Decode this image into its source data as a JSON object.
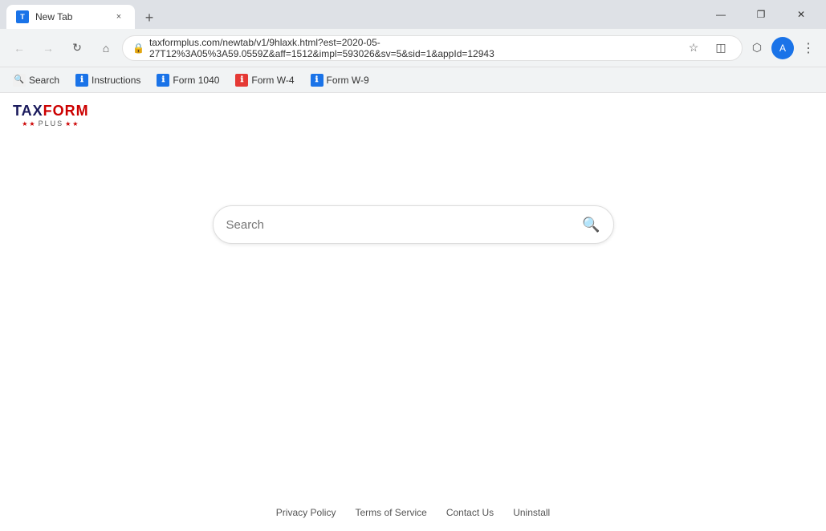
{
  "titlebar": {
    "tab_favicon": "T",
    "tab_title": "New Tab",
    "tab_close": "×",
    "new_tab_btn": "+",
    "win_minimize": "—",
    "win_maximize": "❐",
    "win_close": "✕"
  },
  "addressbar": {
    "back_icon": "←",
    "forward_icon": "→",
    "refresh_icon": "↻",
    "home_icon": "⌂",
    "lock_icon": "🔒",
    "url": "taxformplus.com/newtab/v1/9hlaxk.html?est=2020-05-27T12%3A05%3A59.0559Z&aff=1512&impl=593026&sv=5&sid=1&appId=12943",
    "bookmark_icon": "☆",
    "screenshot_icon": "◫",
    "extensions_icon": "⬡",
    "profile_letter": "A",
    "menu_icon": "⋮"
  },
  "bookmarkbar": {
    "items": [
      {
        "label": "Search",
        "icon_text": "🔍",
        "icon_bg": "#f0f0f0"
      },
      {
        "label": "Instructions",
        "icon_text": "ℹ",
        "icon_bg": "#1a73e8",
        "icon_color": "#fff"
      },
      {
        "label": "Form 1040",
        "icon_text": "ℹ",
        "icon_bg": "#1a73e8",
        "icon_color": "#fff"
      },
      {
        "label": "Form W-4",
        "icon_text": "ℹ",
        "icon_bg": "#e53935",
        "icon_color": "#fff"
      },
      {
        "label": "Form W-9",
        "icon_text": "ℹ",
        "icon_bg": "#1a73e8",
        "icon_color": "#fff"
      }
    ]
  },
  "logo": {
    "main": "TAXFORM",
    "sub_prefix": "★★",
    "sub_label": "PLUS",
    "sub_suffix": "★★"
  },
  "search": {
    "placeholder": "Search",
    "icon": "🔍"
  },
  "footer": {
    "links": [
      "Privacy Policy",
      "Terms of Service",
      "Contact Us",
      "Uninstall"
    ]
  }
}
